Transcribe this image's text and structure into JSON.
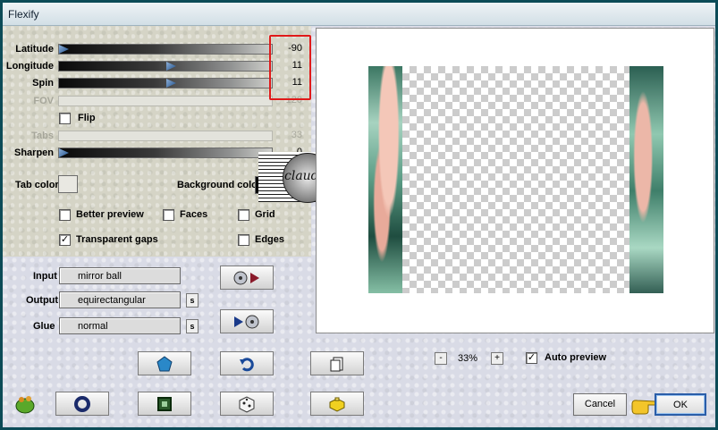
{
  "window": {
    "title": "Flexify"
  },
  "sliders": [
    {
      "label": "Latitude",
      "value": "-90",
      "fraction": 0.0,
      "enabled": true
    },
    {
      "label": "Longitude",
      "value": "11",
      "fraction": 0.53,
      "enabled": true
    },
    {
      "label": "Spin",
      "value": "11",
      "fraction": 0.53,
      "enabled": true
    },
    {
      "label": "FOV",
      "value": "120",
      "fraction": 1.0,
      "enabled": false
    },
    {
      "label": "Tabs",
      "value": "33",
      "fraction": 0.33,
      "enabled": false
    },
    {
      "label": "Sharpen",
      "value": "0",
      "fraction": 0.0,
      "enabled": true
    }
  ],
  "flip": {
    "label": "Flip",
    "checked": false
  },
  "tab_color": {
    "label": "Tab color",
    "color": "#e9e8e2"
  },
  "background_color": {
    "label": "Background color",
    "color": "#000000"
  },
  "options": {
    "better_preview": {
      "label": "Better preview",
      "checked": false
    },
    "faces": {
      "label": "Faces",
      "checked": false
    },
    "grid": {
      "label": "Grid",
      "checked": false
    },
    "transparent_gaps": {
      "label": "Transparent gaps",
      "checked": true
    },
    "edges": {
      "label": "Edges",
      "checked": false
    }
  },
  "io": {
    "input": {
      "label": "Input",
      "value": "mirror ball"
    },
    "output": {
      "label": "Output",
      "value": "equirectangular",
      "button": "s"
    },
    "glue": {
      "label": "Glue",
      "value": "normal",
      "button": "s"
    }
  },
  "zoom": {
    "minus": "-",
    "value": "33%",
    "plus": "+"
  },
  "auto_preview": {
    "label": "Auto preview",
    "checked": true
  },
  "buttons": {
    "cancel": "Cancel",
    "ok": "OK"
  },
  "watermark": {
    "text": "claudia"
  },
  "colors": {
    "highlight_box": "#e01a1a",
    "ok_border": "#2a5da8"
  }
}
